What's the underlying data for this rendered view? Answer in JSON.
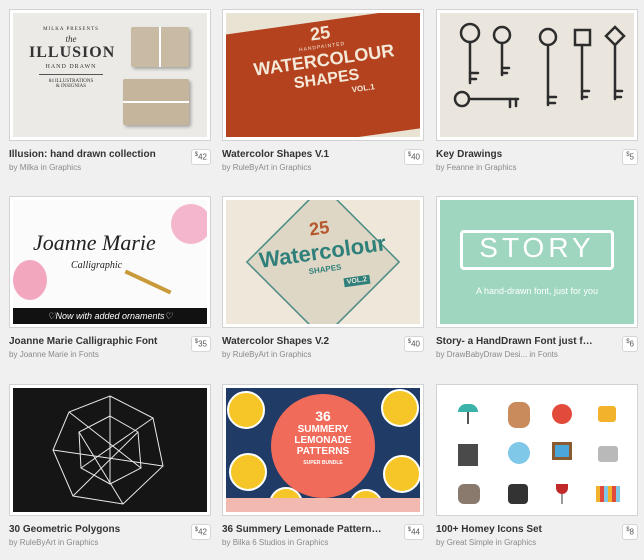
{
  "products": [
    {
      "title": "Illusion: hand drawn collection",
      "by": "by",
      "author": "Milka",
      "in": "in",
      "category": "Graphics",
      "price": "42",
      "art": {
        "presents": "MILKA PRESENTS",
        "the": "the",
        "big": "ILLUSION",
        "sub": "HAND DRAWN",
        "foot1": "84 ILLUSTRATIONS",
        "foot2": "& INSIGNIAS"
      }
    },
    {
      "title": "Watercolor Shapes V.1",
      "by": "by",
      "author": "RuleByArt",
      "in": "in",
      "category": "Graphics",
      "price": "40",
      "art": {
        "num": "25",
        "hand": "HANDPAINTED",
        "big": "WATERCOLOUR",
        "big2": "SHAPES",
        "vol": "VOL.1"
      }
    },
    {
      "title": "Key Drawings",
      "by": "by",
      "author": "Feanne",
      "in": "in",
      "category": "Graphics",
      "price": "5"
    },
    {
      "title": "Joanne Marie Calligraphic Font",
      "by": "by",
      "author": "Joanne Marie",
      "in": "in",
      "category": "Fonts",
      "price": "35",
      "art": {
        "name": "Joanne Marie",
        "sub": "Calligraphic",
        "banner": "♡Now with added ornaments♡"
      }
    },
    {
      "title": "Watercolor Shapes V.2",
      "by": "by",
      "author": "RuleByArt",
      "in": "in",
      "category": "Graphics",
      "price": "40",
      "art": {
        "num": "25",
        "big": "Watercolour",
        "sub": "SHAPES",
        "vol": "VOL.2"
      }
    },
    {
      "title": "Story- a HandDrawn Font just for ...",
      "by": "by",
      "author": "DrawBabyDraw Desi...",
      "in": "in",
      "category": "Fonts",
      "price": "6",
      "art": {
        "word": "STORY",
        "tag": "A hand-drawn font, just for you"
      }
    },
    {
      "title": "30 Geometric Polygons",
      "by": "by",
      "author": "RuleByArt",
      "in": "in",
      "category": "Graphics",
      "price": "42"
    },
    {
      "title": "36 Summery Lemonade Patterns ...",
      "by": "by",
      "author": "Bilka 6 Studios",
      "in": "in",
      "category": "Graphics",
      "price": "44",
      "art": {
        "num": "36",
        "l1": "SUMMERY",
        "l2": "LEMONADE",
        "l3": "PATTERNS",
        "l4": "SUPER BUNDLE"
      }
    },
    {
      "title": "100+ Homey Icons Set",
      "by": "by",
      "author": "Great Simple",
      "in": "in",
      "category": "Graphics",
      "price": "8"
    }
  ],
  "currency": "$"
}
